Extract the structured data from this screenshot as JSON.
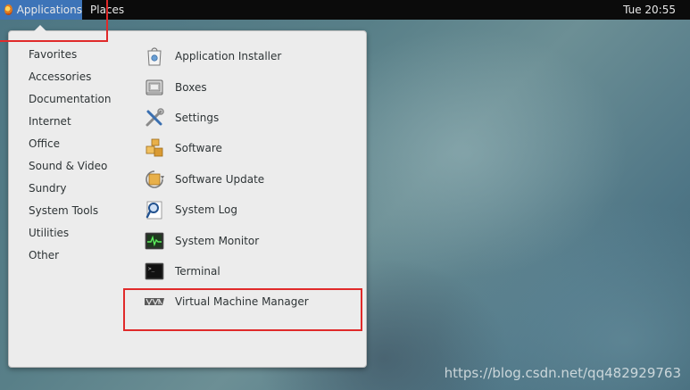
{
  "topbar": {
    "applications_label": "Applications",
    "places_label": "Places",
    "clock": "Tue 20:55"
  },
  "menu": {
    "categories": [
      "Favorites",
      "Accessories",
      "Documentation",
      "Internet",
      "Office",
      "Sound & Video",
      "Sundry",
      "System Tools",
      "Utilities",
      "Other"
    ],
    "apps": [
      {
        "label": "Application Installer",
        "icon": "application-installer-icon"
      },
      {
        "label": "Boxes",
        "icon": "boxes-icon"
      },
      {
        "label": "Settings",
        "icon": "settings-icon"
      },
      {
        "label": "Software",
        "icon": "software-icon"
      },
      {
        "label": "Software Update",
        "icon": "software-update-icon"
      },
      {
        "label": "System Log",
        "icon": "system-log-icon"
      },
      {
        "label": "System Monitor",
        "icon": "system-monitor-icon"
      },
      {
        "label": "Terminal",
        "icon": "terminal-icon"
      },
      {
        "label": "Virtual Machine Manager",
        "icon": "virtual-machine-manager-icon"
      }
    ]
  },
  "watermark": "https://blog.csdn.net/qq482929763",
  "colors": {
    "topbar": "#0b0b0b",
    "applications_active": "#3d74b8",
    "menu_background": "#ececec",
    "highlight": "#e02a2a"
  }
}
